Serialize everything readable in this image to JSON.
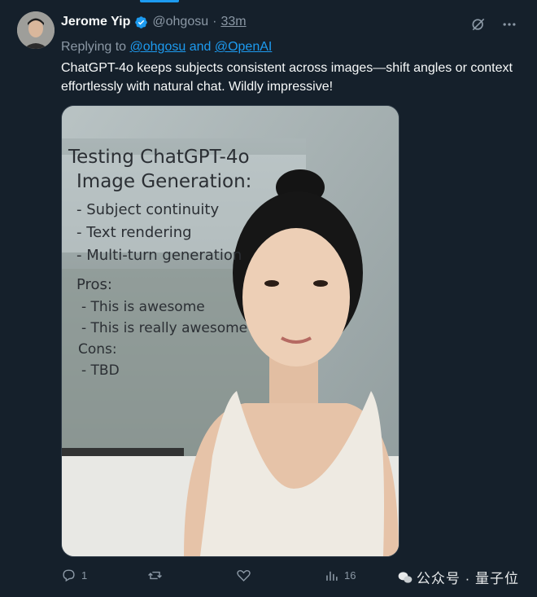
{
  "tweet": {
    "author_name": "Jerome Yip",
    "handle": "@ohgosu",
    "separator": "·",
    "time": "33m",
    "replying_prefix": "Replying to",
    "reply_to_1": "@ohgosu",
    "reply_and": "and",
    "reply_to_2": "@OpenAI",
    "text": "ChatGPT-4o keeps subjects consistent across images—shift angles or context effortlessly with natural chat. Wildly impressive!"
  },
  "image": {
    "whiteboard_lines": [
      "Testing ChatGPT-4o",
      "Image Generation:",
      "- Subject continuity",
      "- Text rendering",
      "- Multi-turn generation",
      "Pros:",
      "- This is awesome",
      "- This is really awesome",
      "Cons:",
      "- TBD"
    ]
  },
  "actions": {
    "replies": "1",
    "retweets": "",
    "likes": "",
    "views": "16"
  },
  "watermark": "公众号 · 量子位",
  "colors": {
    "background": "#15202b",
    "link": "#1d9bf0",
    "muted": "#8b98a5"
  }
}
